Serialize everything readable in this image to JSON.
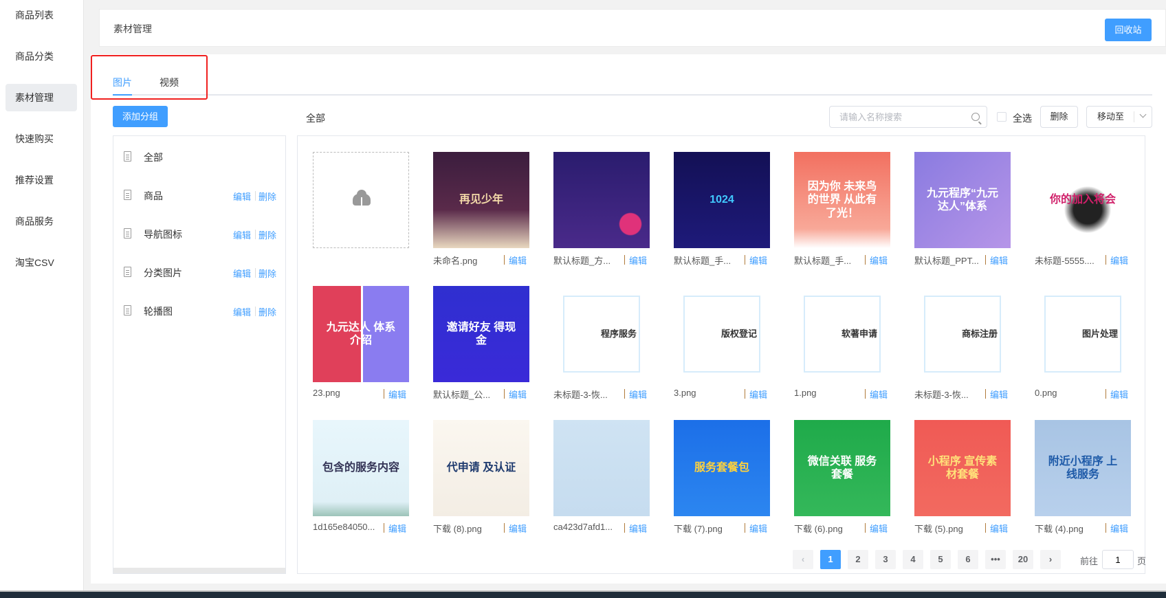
{
  "sidebar": {
    "items": [
      {
        "label": "商品列表"
      },
      {
        "label": "商品分类"
      },
      {
        "label": "素材管理",
        "active": true
      },
      {
        "label": "快速购买"
      },
      {
        "label": "推荐设置"
      },
      {
        "label": "商品服务"
      },
      {
        "label": "淘宝CSV"
      }
    ]
  },
  "header": {
    "title": "素材管理",
    "recycle_label": "回收站"
  },
  "tabs": [
    {
      "label": "图片",
      "active": true
    },
    {
      "label": "视频"
    }
  ],
  "toolbar": {
    "add_group_label": "添加分组",
    "current_group": "全部",
    "search_placeholder": "请输入名称搜索",
    "select_all_label": "全选",
    "delete_label": "删除",
    "move_to_label": "移动至"
  },
  "groups": {
    "edit_label": "编辑",
    "delete_label": "删除",
    "items": [
      {
        "name": "全部",
        "editable": false
      },
      {
        "name": "商品",
        "editable": true
      },
      {
        "name": "导航图标",
        "editable": true
      },
      {
        "name": "分类图片",
        "editable": true
      },
      {
        "name": "轮播图",
        "editable": true
      }
    ]
  },
  "files": {
    "edit_label": "编辑",
    "items": [
      {
        "name": "未命名.png",
        "caption": "再见少年",
        "bg": "linear-gradient(#3b1d3e,#5a2a4a 60%,#e9d8c0)",
        "fg": "#f3d9a8"
      },
      {
        "name": "默认标题_方...",
        "caption": "",
        "bg": "radial-gradient(circle at 80% 75%,#e0327a 0 10%,transparent 11%),linear-gradient(#2a1c6e,#4a2a8a)",
        "fg": "#fff"
      },
      {
        "name": "默认标题_手...",
        "caption": "1024",
        "bg": "linear-gradient(#131055,#1e1a7a)",
        "fg": "#41c9ff"
      },
      {
        "name": "默认标题_手...",
        "caption": "因为你 未来鸟的世界 从此有了光！",
        "bg": "linear-gradient(#f27060,#f8a898 80%,#fff)",
        "fg": "#fff"
      },
      {
        "name": "默认标题_PPT...",
        "caption": "九元程序“九元达人”体系",
        "bg": "linear-gradient(135deg,#8a7be0,#b695e8)",
        "fg": "#fff"
      },
      {
        "name": "未标题-5555....",
        "caption": "你的加入将会",
        "bg": "radial-gradient(circle at 55% 60%,#222 0 18%,transparent 30%),#fff",
        "fg": "#d0206a"
      },
      {
        "name": "23.png",
        "caption": "九元达人 体系介绍",
        "bg": "linear-gradient(90deg,#e0405a 0 50%,#fff 50% 52%,#8a7cf0 52%)",
        "fg": "#fff"
      },
      {
        "name": "默认标题_公...",
        "caption": "邀请好友 得现金",
        "bg": "linear-gradient(#2f2fd0,#3a2ad8)",
        "fg": "#fff"
      },
      {
        "name": "未标题-3-恢...",
        "caption": "程序服务",
        "bg": "#fff",
        "fg": "#333",
        "card": true
      },
      {
        "name": "3.png",
        "caption": "版权登记",
        "bg": "#fff",
        "fg": "#333",
        "card": true
      },
      {
        "name": "1.png",
        "caption": "软著申请",
        "bg": "#fff",
        "fg": "#333",
        "card": true
      },
      {
        "name": "未标题-3-恢...",
        "caption": "商标注册",
        "bg": "#fff",
        "fg": "#333",
        "card": true
      },
      {
        "name": "0.png",
        "caption": "图片处理",
        "bg": "#fff",
        "fg": "#333",
        "card": true
      },
      {
        "name": "1d165e84050...",
        "caption": "包含的服务内容",
        "bg": "linear-gradient(#e8f6fc,#dff0f6 85%,#9cc3b8)",
        "fg": "#335"
      },
      {
        "name": "下载 (8).png",
        "caption": "代申请 及认证",
        "bg": "linear-gradient(#fbf7f0,#f3ede4)",
        "fg": "#1e3a6e"
      },
      {
        "name": "ca423d7afd1...",
        "caption": "",
        "bg": "linear-gradient(#cfe3f3,#c6dcef)",
        "fg": "#335"
      },
      {
        "name": "下载 (7).png",
        "caption": "服务套餐包",
        "bg": "linear-gradient(#1c6fe8,#2c86f0)",
        "fg": "#ffd23c"
      },
      {
        "name": "下载 (6).png",
        "caption": "微信关联 服务套餐",
        "bg": "linear-gradient(#1faa4a,#34b85a)",
        "fg": "#fff"
      },
      {
        "name": "下载 (5).png",
        "caption": "小程序 宣传素材套餐",
        "bg": "linear-gradient(#f05a55,#f26a60)",
        "fg": "#ffe27a"
      },
      {
        "name": "下载 (4).png",
        "caption": "附近小程序 上线服务",
        "bg": "linear-gradient(#a8c4e4,#b8d0ec)",
        "fg": "#1e5aa8"
      }
    ]
  },
  "pagination": {
    "pages": [
      "1",
      "2",
      "3",
      "4",
      "5",
      "6",
      "•••",
      "20"
    ],
    "current": "1",
    "prev": "‹",
    "next": "›",
    "goto_prefix": "前往",
    "goto_value": "1",
    "goto_suffix": "页"
  }
}
